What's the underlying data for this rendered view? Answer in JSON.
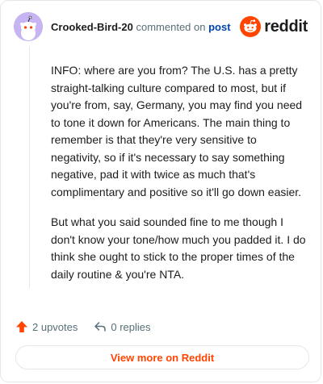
{
  "header": {
    "username": "Crooked-Bird-20",
    "commented_text": "commented on",
    "post_link": "post",
    "brand": "reddit",
    "brand_color": "#ff4500"
  },
  "comment": {
    "paragraphs": [
      "INFO: where are you from? The U.S. has a pretty straight-talking culture compared to most, but if you're from, say, Germany, you may find you need to tone it down for Americans. The main thing to remember is that they're very sensitive to negativity, so if it's necessary to say something negative, pad it with twice as much that's complimentary and positive so it'll go down easier.",
      "But what you said sounded fine to me though I don't know your tone/how much you padded it. I do think she ought to stick to the proper times of the daily routine & you're NTA."
    ]
  },
  "actions": {
    "upvotes": "2 upvotes",
    "replies": "0 replies",
    "upvote_icon": "upvote-arrow-icon",
    "reply_icon": "reply-arrow-icon"
  },
  "footer": {
    "view_more": "View more on Reddit"
  }
}
